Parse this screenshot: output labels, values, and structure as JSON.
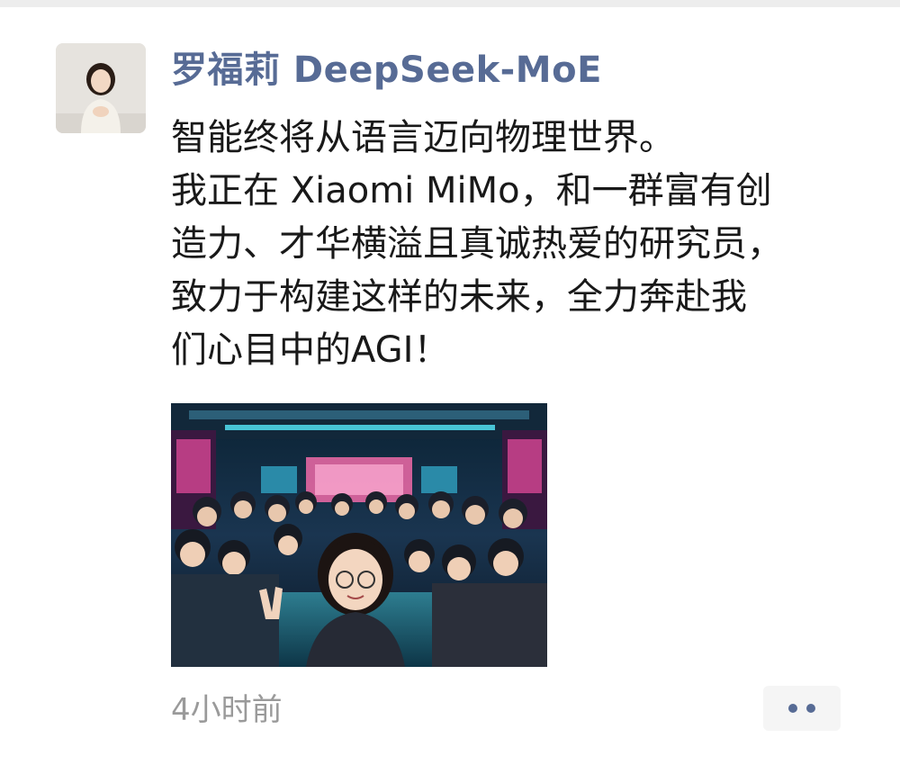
{
  "post": {
    "author": "罗福莉 DeepSeek-MoE",
    "text_lines": [
      "智能终将从语言迈向物理世界。",
      "我正在 Xiaomi MiMo，和一群富有创",
      "造力、才华横溢且真诚热爱的研究员，",
      "致力于构建这样的未来，全力奔赴我",
      "们心目中的AGI！"
    ],
    "timestamp": "4小时前",
    "more_icon": "more-dots-icon",
    "image": {
      "subject": "comic-style group selfie",
      "image_name": "team-selfie-image"
    },
    "colors": {
      "author_link": "#576b95",
      "text": "#191919",
      "meta": "#9a9a9a",
      "more_bg": "#f5f5f5"
    }
  }
}
